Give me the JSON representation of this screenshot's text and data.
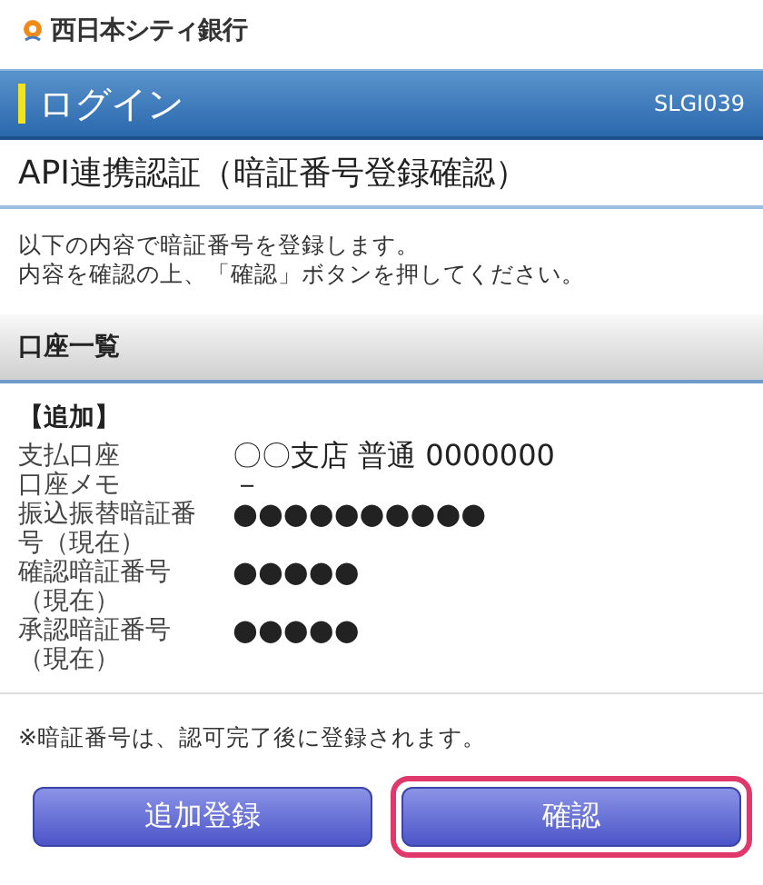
{
  "bank": {
    "name": "西日本シティ銀行"
  },
  "header": {
    "title": "ログイン",
    "code": "SLGI039"
  },
  "page_title": "API連携認証（暗証番号登録確認）",
  "intro": [
    "以下の内容で暗証番号を登録します。",
    "内容を確認の上、「確認」ボタンを押してください。"
  ],
  "section": {
    "title": "口座一覧"
  },
  "group_label": "【追加】",
  "rows": [
    {
      "label": "支払口座",
      "value": "〇〇支店 普通 0000000"
    },
    {
      "label": "口座メモ",
      "value": "－"
    },
    {
      "label": "振込振替暗証番号（現在）",
      "value": "●●●●●●●●●●"
    },
    {
      "label": "確認暗証番号（現在）",
      "value": "●●●●●"
    },
    {
      "label": "承認暗証番号（現在）",
      "value": "●●●●●"
    }
  ],
  "note": "※暗証番号は、認可完了後に登録されます。",
  "buttons": [
    {
      "label": "追加登録",
      "highlighted": false
    },
    {
      "label": "確認",
      "highlighted": true
    }
  ]
}
